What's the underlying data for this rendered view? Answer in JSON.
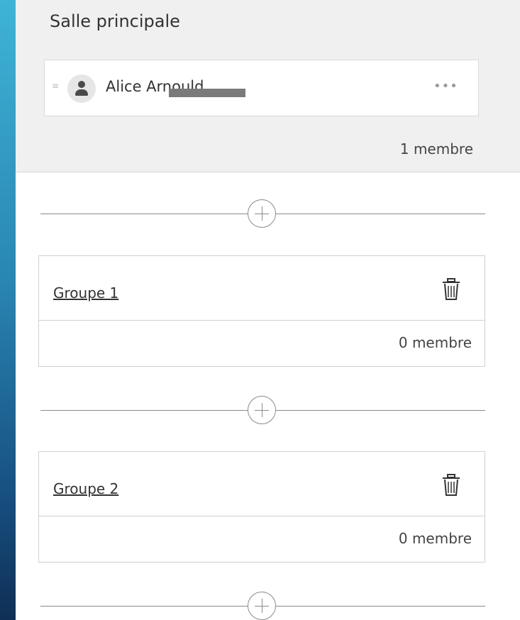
{
  "main_room": {
    "title": "Salle principale",
    "member": {
      "name": "Alice Arnould"
    },
    "count": "1 membre"
  },
  "groups": [
    {
      "name": "Groupe 1",
      "count": "0 membre"
    },
    {
      "name": "Groupe 2",
      "count": "0 membre"
    }
  ],
  "icons": {
    "avatar": "user-icon",
    "more": "more-options-icon",
    "add": "add-circle-icon",
    "delete": "trash-icon",
    "drag": "drag-handle-icon"
  },
  "colors": {
    "main_room_bg": "#f0f0f0",
    "border": "#d0d0d0",
    "accent_left": "#2a86b3"
  }
}
